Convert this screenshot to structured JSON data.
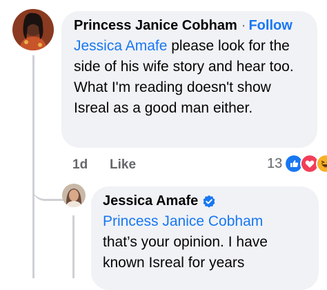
{
  "comments": [
    {
      "author": "Princess Janice Cobham",
      "separator": "·",
      "follow_label": "Follow",
      "mention": "Jessica Amafe",
      "text_after_mention": " please look for the side of his wife story and hear too.",
      "text_line2": "What I'm reading doesn't show Isreal as a good man either.",
      "time": "1d",
      "like_label": "Like",
      "reaction_count": "13",
      "reactions": [
        "like-icon",
        "love-icon",
        "haha-icon"
      ]
    }
  ],
  "reply": {
    "author": "Jessica Amafe",
    "verified": true,
    "mention": "Princess Janice Cobham",
    "text": "that’s your opinion. I have known Isreal for years"
  },
  "colors": {
    "bubble": "#f0f2f5",
    "link": "#1877f2",
    "muted": "#65676b",
    "thread_line": "#ced0d4"
  }
}
